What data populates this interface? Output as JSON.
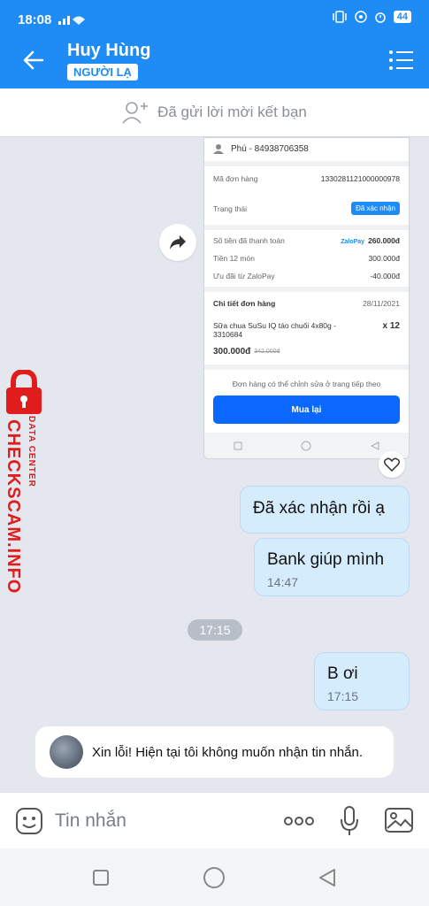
{
  "status_bar": {
    "time": "18:08",
    "battery": "44"
  },
  "header": {
    "contact_name": "Huy Hùng",
    "badge": "NGƯỜI LẠ"
  },
  "invite": {
    "text": "Đã gửi lời mời kết bạn"
  },
  "order_card": {
    "contact_line": "Phú - 84938706358",
    "order_id_label": "Mã đơn hàng",
    "order_id": "1330281121000000978",
    "status_label": "Trạng thái",
    "status_value": "Đã xác nhận",
    "paid_label": "Số tiền đã thanh toán",
    "paid_brand": "ZaloPay",
    "paid_value": "260.000đ",
    "items_label": "Tiền 12 món",
    "items_value": "300.000đ",
    "discount_label": "Ưu đãi từ ZaloPay",
    "discount_value": "-40.000đ",
    "detail_label": "Chi tiết đơn hàng",
    "detail_date": "28/11/2021",
    "product_name": "Sữa chua SuSu IQ táo chuối 4x80g - 3310684",
    "product_qty": "x 12",
    "product_price": "300.000đ",
    "product_old_price": "342.000đ",
    "note": "Đơn hàng có thể chỉnh sửa ở trang tiếp theo",
    "buy_again": "Mua lại"
  },
  "messages": [
    {
      "text": "Đã xác nhận rồi ạ",
      "time": ""
    },
    {
      "text": "Bank giúp mình",
      "time": "14:47"
    },
    {
      "text": "B ơi",
      "time": "17:15"
    }
  ],
  "time_divider": "17:15",
  "auto_reply": "Xin lỗi! Hiện tại tôi không muốn nhận tin nhắn.",
  "watermark": {
    "brand": "CHECKSCAM.INFO",
    "sub": "DATA CENTER"
  },
  "composer": {
    "placeholder": "Tin nhắn"
  },
  "colors": {
    "brand": "#1f8cf5",
    "bubble": "#d5ecfd",
    "watermark": "#e01c1c"
  }
}
